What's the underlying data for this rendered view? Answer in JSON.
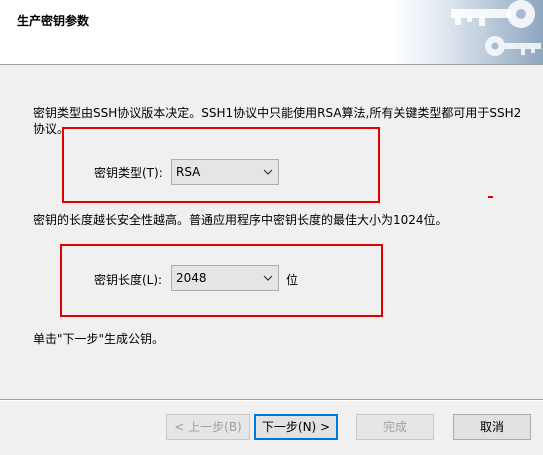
{
  "header": {
    "title": "生产密钥参数"
  },
  "content": {
    "description_1": "密钥类型由SSH协议版本决定。SSH1协议中只能使用RSA算法,所有关键类型都可用于SSH2协议。",
    "key_type_label": "密钥类型(T):",
    "key_type_value": "RSA",
    "description_2": "密钥的长度越长安全性越高。普通应用程序中密钥长度的最佳大小为1024位。",
    "key_length_label": "密钥长度(L):",
    "key_length_value": "2048",
    "key_length_unit": "位",
    "finish_note": "单击\"下一步\"生成公钥。"
  },
  "buttons": {
    "prev": "< 上一步(B)",
    "next": "下一步(N) >",
    "finish": "完成",
    "cancel": "取消"
  },
  "icons": {
    "header_graphic": "keys-icon",
    "dropdown": "chevron-down-icon"
  },
  "colors": {
    "annotation_red": "#e00000",
    "focus_blue": "#0078d7"
  }
}
